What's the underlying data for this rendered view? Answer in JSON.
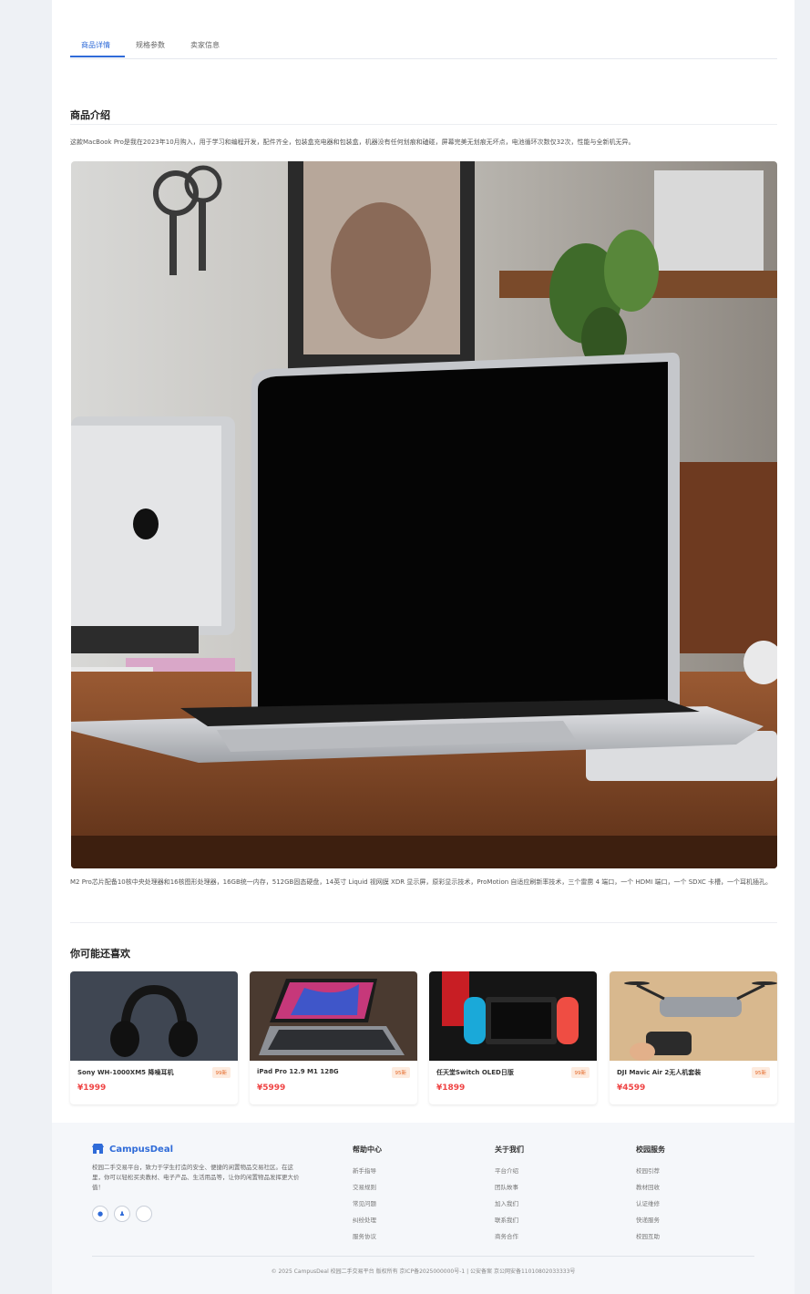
{
  "tabs": [
    {
      "label": "商品详情",
      "active": true
    },
    {
      "label": "规格参数",
      "active": false
    },
    {
      "label": "卖家信息",
      "active": false
    }
  ],
  "intro_section": {
    "title": "商品介绍",
    "description": "这款MacBook Pro是我在2023年10月购入，用于学习和编程开发，配件齐全，包装盒充电器和包装盒，机器没有任何划痕和磕碰，屏幕完美无划痕无坏点，电池循环次数仅32次，性能与全新机无异。",
    "image_alt": "MacBook Pro",
    "spec": "M2 Pro芯片配备10核中央处理器和16核图形处理器，16GB统一内存，512GB固态硬盘，14英寸 Liquid 视网膜 XDR 显示屏，原彩显示技术，ProMotion 自适应刷新率技术，三个雷雳 4 端口，一个 HDMI 端口，一个 SDXC 卡槽，一个耳机插孔。"
  },
  "recommend": {
    "title": "你可能还喜欢",
    "items": [
      {
        "name": "Sony WH-1000XM5 降噪耳机",
        "badge": "99新",
        "price": "¥1999"
      },
      {
        "name": "iPad Pro 12.9 M1 128G",
        "badge": "95新",
        "price": "¥5999"
      },
      {
        "name": "任天堂Switch OLED日版",
        "badge": "99新",
        "price": "¥1899"
      },
      {
        "name": "DJI Mavic Air 2无人机套装",
        "badge": "95新",
        "price": "¥4599"
      }
    ]
  },
  "footer": {
    "brand": "CampusDeal",
    "intro": "校园二手交易平台，致力于学生打造的安全、便捷的闲置物品交易社区。在这里，你可以轻松买卖教材、电子产品、生活用品等，让你的闲置物品发挥更大价值！",
    "columns": [
      {
        "title": "帮助中心",
        "links": [
          "新手指导",
          "交易规则",
          "常见问题",
          "纠纷处理",
          "服务协议"
        ]
      },
      {
        "title": "关于我们",
        "links": [
          "平台介绍",
          "团队故事",
          "加入我们",
          "联系我们",
          "商务合作"
        ]
      },
      {
        "title": "校园服务",
        "links": [
          "校园引荐",
          "教材回收",
          "认证维修",
          "快递服务",
          "校园互助"
        ]
      }
    ],
    "copyright": "© 2025 CampusDeal 校园二手交易平台 版权所有 京ICP备2025000000号-1 | 公安备案 京公网安备11010802033333号"
  },
  "colors": {
    "accent": "#2f6bd8",
    "price": "#ef4444",
    "badge": "#e46a2a"
  }
}
